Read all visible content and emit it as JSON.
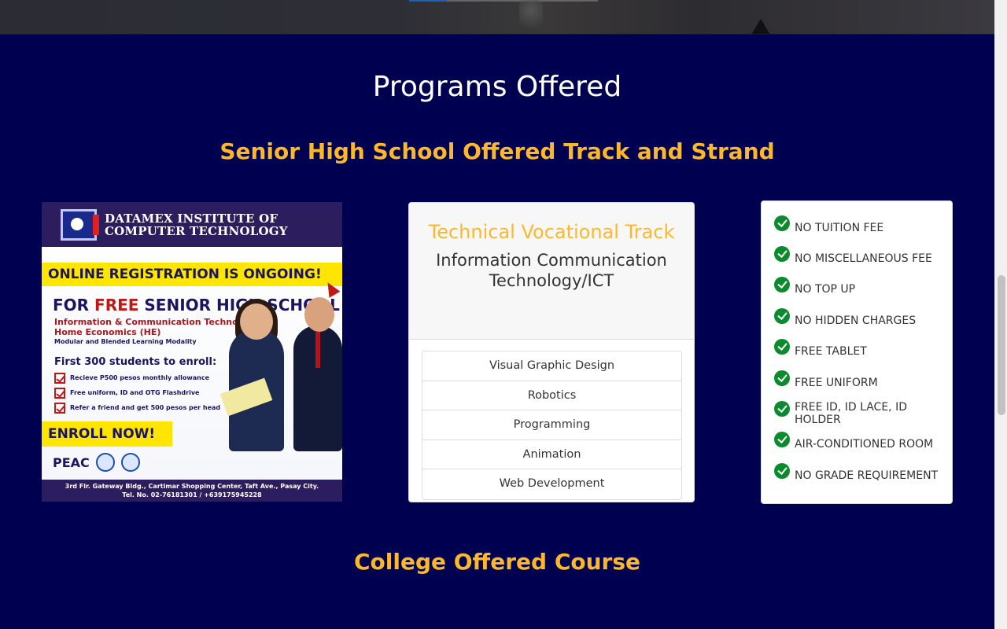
{
  "section": {
    "title": "Programs Offered",
    "shs_title": "Senior High School Offered Track and Strand",
    "college_title": "College Offered Course"
  },
  "poster": {
    "school_line1": "DATAMEX INSTITUTE OF",
    "school_line2": "COMPUTER TECHNOLOGY",
    "banner": "ONLINE REGISTRATION IS ONGOING!",
    "free_prefix": "FOR ",
    "free_word": "FREE",
    "free_suffix": " SENIOR HIGH SCHOOL",
    "info_line1": "Information & Communication Technology ICT",
    "info_line2": "Home Economics (HE)",
    "modality": "Modular and Blended Learning Modality",
    "first300": "First 300 students to enroll:",
    "perks": [
      "Recieve P500 pesos monthly allowance",
      "Free uniform, ID and OTG Flashdrive",
      "Refer a friend and get 500 pesos per head"
    ],
    "enroll": "ENROLL NOW!",
    "peac": "PEAC",
    "footer_line1": "3rd Flr. Gateway Bldg., Cartimar Shopping Center, Taft Ave., Pasay City.",
    "footer_line2": "Tel. No. 02-76181301 / +639175945228"
  },
  "track_card": {
    "track": "Technical Vocational Track",
    "strand": "Information Communication Technology/ICT",
    "specializations": [
      "Visual Graphic Design",
      "Robotics",
      "Programming",
      "Animation",
      "Web Development"
    ]
  },
  "benefits": [
    "NO TUITION FEE",
    "NO MISCELLANEOUS FEE",
    "NO TOP UP",
    "NO HIDDEN CHARGES",
    "FREE TABLET",
    "FREE UNIFORM",
    "FREE ID, ID LACE, ID HOLDER",
    "AIR-CONDITIONED ROOM",
    "NO GRADE REQUIREMENT"
  ],
  "colors": {
    "background": "#000050",
    "accent_gold": "#fdb829",
    "check_green": "#0c8b2e"
  },
  "icons": {
    "benefit": "check-circle-icon"
  }
}
